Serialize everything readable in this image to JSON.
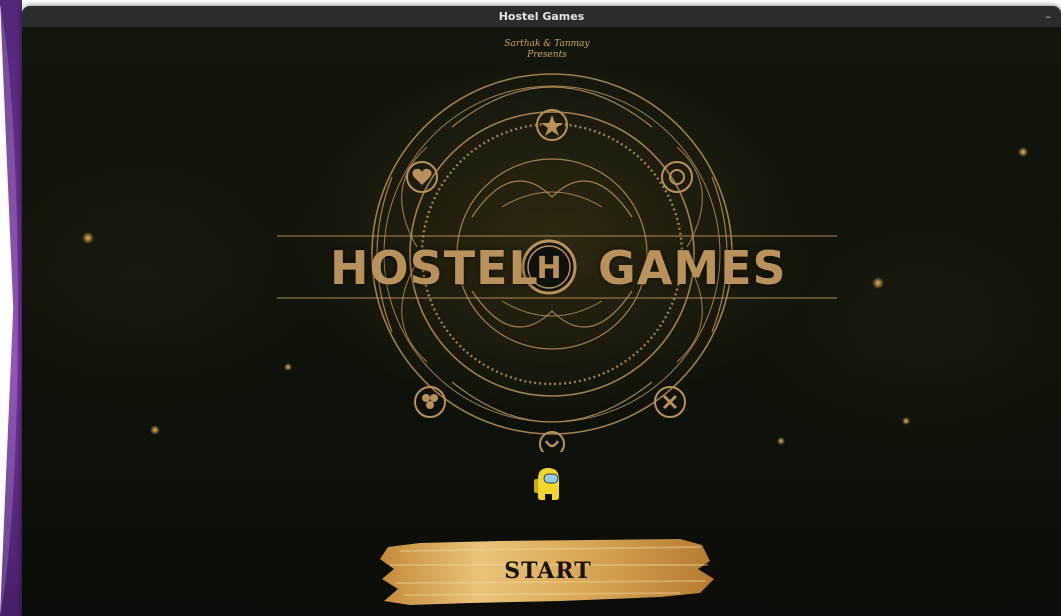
{
  "window": {
    "title": "Hostel Games",
    "minimize_label": "–"
  },
  "splash": {
    "credit_line1": "Sarthak & Tanmay",
    "credit_line2": "Presents",
    "brand_left": "HOSTEL",
    "brand_monogram": "H",
    "brand_right": "GAMES"
  },
  "start_button": {
    "label": "START"
  },
  "colors": {
    "gold": "#b8925a",
    "gold_light": "#e2b66a",
    "background": "#0f110a",
    "titlebar": "#2c2c2c",
    "crewmate_yellow": "#f4d62a",
    "crewmate_visor": "#8fd0e6"
  },
  "icons": [
    "star-icon",
    "heart-icon",
    "circle-icon",
    "clover-icon",
    "cross-icon",
    "crescent-icon",
    "crewmate-icon"
  ]
}
